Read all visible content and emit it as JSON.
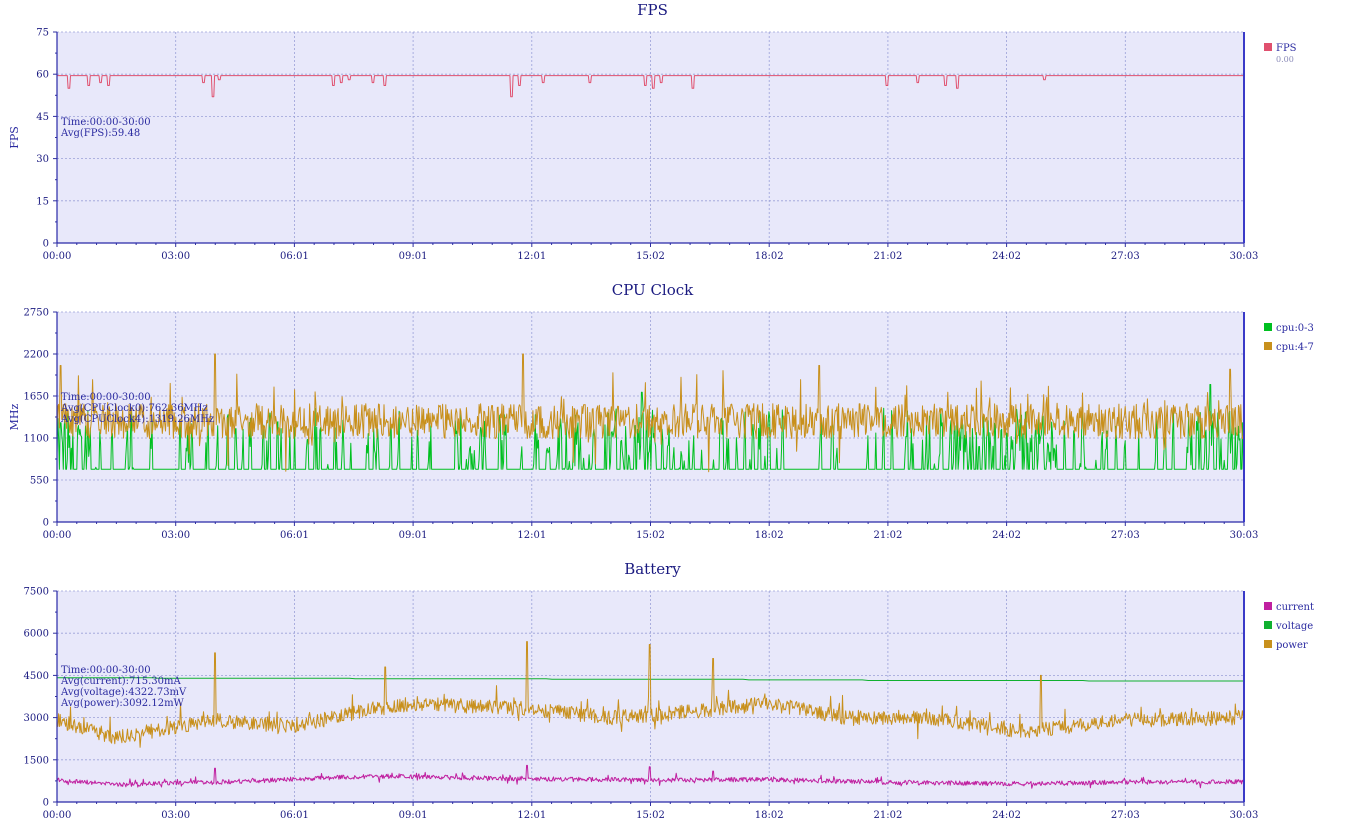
{
  "chart_data": [
    {
      "type": "line",
      "title": "FPS",
      "ylabel": "FPS",
      "ylim": [
        0,
        75
      ],
      "yticks": [
        "0",
        "15",
        "30",
        "45",
        "60",
        "75"
      ],
      "xlabels": [
        "00:00",
        "03:00",
        "06:01",
        "09:01",
        "12:01",
        "15:02",
        "18:02",
        "21:02",
        "24:02",
        "27:03",
        "30:03"
      ],
      "grid": true,
      "legend_position": "right",
      "annotation": [
        "Time:00:00-30:00",
        "Avg(FPS):59.48"
      ],
      "series": [
        {
          "name": "FPS",
          "legend_value": "0.00",
          "color": "#e0506e",
          "baseline": 59.5,
          "dips": [
            [
              0.3,
              55
            ],
            [
              0.8,
              56
            ],
            [
              1.1,
              57
            ],
            [
              1.3,
              56
            ],
            [
              3.7,
              57
            ],
            [
              3.95,
              52
            ],
            [
              4.1,
              58
            ],
            [
              7.0,
              56
            ],
            [
              7.2,
              57
            ],
            [
              7.4,
              58
            ],
            [
              8.0,
              57
            ],
            [
              8.3,
              56
            ],
            [
              11.5,
              52
            ],
            [
              11.7,
              56
            ],
            [
              12.3,
              57
            ],
            [
              13.5,
              57
            ],
            [
              14.9,
              56
            ],
            [
              15.1,
              55
            ],
            [
              15.3,
              57
            ],
            [
              16.1,
              55
            ],
            [
              21.0,
              56
            ],
            [
              21.8,
              57
            ],
            [
              22.5,
              56
            ],
            [
              22.8,
              55
            ],
            [
              25.0,
              58
            ]
          ]
        }
      ]
    },
    {
      "type": "line",
      "title": "CPU Clock",
      "ylabel": "MHz",
      "ylim": [
        0,
        2750
      ],
      "yticks": [
        "0",
        "550",
        "1100",
        "1650",
        "2200",
        "2750"
      ],
      "xlabels": [
        "00:00",
        "03:00",
        "06:01",
        "09:01",
        "12:01",
        "15:02",
        "18:02",
        "21:02",
        "24:02",
        "27:03",
        "30:03"
      ],
      "grid": true,
      "legend_position": "right",
      "annotation": [
        "Time:00:00-30:00",
        "Avg(CPUClock0):762.36MHz",
        "Avg(CPUClock4):1319.26MHz"
      ],
      "series": [
        {
          "name": "cpu:0-3",
          "color": "#00c020",
          "base": 690,
          "spike_max": 1600,
          "spike_prob": 0.12,
          "peaks": [
            [
              0.1,
              1300
            ],
            [
              14.8,
              1700
            ],
            [
              24.4,
              1400
            ],
            [
              29.2,
              1800
            ]
          ]
        },
        {
          "name": "cpu:4-7",
          "color": "#c8901c",
          "mean": 1320,
          "spread": 230,
          "spike_max": 2200,
          "peaks": [
            [
              0.1,
              2050
            ],
            [
              4.0,
              2200
            ],
            [
              11.8,
              2200
            ],
            [
              19.3,
              2050
            ],
            [
              29.7,
              2000
            ]
          ]
        }
      ]
    },
    {
      "type": "line",
      "title": "Battery",
      "ylim": [
        0,
        7500
      ],
      "yticks": [
        "0",
        "1500",
        "3000",
        "4500",
        "6000",
        "7500"
      ],
      "xlabels": [
        "00:00",
        "03:00",
        "06:01",
        "09:01",
        "12:01",
        "15:02",
        "18:02",
        "21:02",
        "24:02",
        "27:03",
        "30:03"
      ],
      "grid": true,
      "legend_position": "right",
      "annotation": [
        "Time:00:00-30:00",
        "Avg(current):715.30mA",
        "Avg(voltage):4322.73mV",
        "Avg(power):3092.12mW"
      ],
      "series": [
        {
          "name": "current",
          "color": "#c020a0",
          "mean": 715,
          "spread": 80,
          "wave": [
            [
              0,
              780
            ],
            [
              1.5,
              620
            ],
            [
              4,
              700
            ],
            [
              8,
              920
            ],
            [
              12,
              820
            ],
            [
              15,
              780
            ],
            [
              18,
              800
            ],
            [
              21,
              700
            ],
            [
              24.5,
              650
            ],
            [
              27,
              700
            ],
            [
              30,
              720
            ]
          ],
          "peaks": [
            [
              4.0,
              1200
            ],
            [
              11.9,
              1300
            ],
            [
              15.0,
              1250
            ],
            [
              16.6,
              1100
            ]
          ]
        },
        {
          "name": "voltage",
          "color": "#10b030",
          "points": [
            [
              0,
              4420
            ],
            [
              5,
              4400
            ],
            [
              10,
              4380
            ],
            [
              20,
              4340
            ],
            [
              21,
              4320
            ],
            [
              26,
              4310
            ],
            [
              30,
              4290
            ]
          ]
        },
        {
          "name": "power",
          "color": "#c8901c",
          "mean": 3092,
          "spread": 260,
          "wave": [
            [
              0,
              2900
            ],
            [
              1.5,
              2300
            ],
            [
              4,
              2900
            ],
            [
              6,
              2700
            ],
            [
              8,
              3300
            ],
            [
              9,
              3500
            ],
            [
              12,
              3300
            ],
            [
              14,
              3000
            ],
            [
              16,
              3200
            ],
            [
              18,
              3500
            ],
            [
              20,
              3000
            ],
            [
              22,
              3000
            ],
            [
              24.5,
              2500
            ],
            [
              27,
              2900
            ],
            [
              30,
              3000
            ]
          ],
          "peaks": [
            [
              4.0,
              5300
            ],
            [
              8.3,
              4800
            ],
            [
              11.9,
              5700
            ],
            [
              15.0,
              5600
            ],
            [
              16.6,
              5100
            ],
            [
              24.9,
              4500
            ]
          ]
        }
      ]
    }
  ]
}
